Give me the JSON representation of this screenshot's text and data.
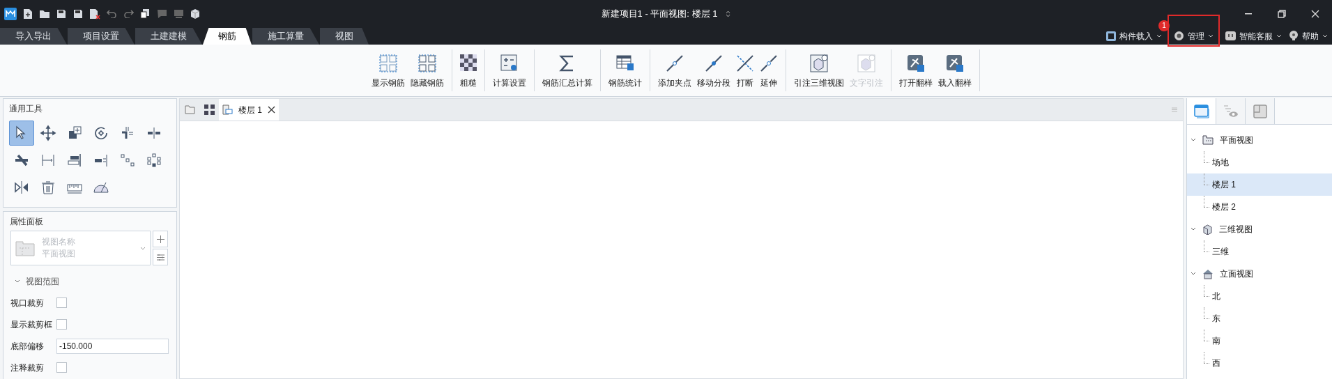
{
  "window": {
    "title": "新建项目1 - 平面视图: 楼层 1"
  },
  "main_tabs": [
    {
      "label": "导入导出",
      "selected": false
    },
    {
      "label": "项目设置",
      "selected": false
    },
    {
      "label": "土建建模",
      "selected": false
    },
    {
      "label": "钢筋",
      "selected": true
    },
    {
      "label": "施工算量",
      "selected": false
    },
    {
      "label": "视图",
      "selected": false
    }
  ],
  "right_menu": [
    {
      "label": "构件载入",
      "kind": "component"
    },
    {
      "label": "管理",
      "kind": "manage",
      "badge": "1",
      "highlighted": true
    },
    {
      "label": "智能客服",
      "kind": "service"
    },
    {
      "label": "帮助",
      "kind": "help"
    }
  ],
  "ribbon_groups": [
    [
      {
        "label": "显示钢筋",
        "kind": "show",
        "disabled": false
      },
      {
        "label": "隐藏钢筋",
        "kind": "hide",
        "disabled": false
      }
    ],
    [
      {
        "label": "粗糙",
        "kind": "rough",
        "disabled": false
      }
    ],
    [
      {
        "label": "计算设置",
        "kind": "calc",
        "disabled": false
      }
    ],
    [
      {
        "label": "钢筋汇总计算",
        "kind": "sum",
        "disabled": false
      }
    ],
    [
      {
        "label": "钢筋统计",
        "kind": "stats",
        "disabled": false
      }
    ],
    [
      {
        "label": "添加夹点",
        "kind": "addpoint",
        "disabled": false
      },
      {
        "label": "移动分段",
        "kind": "move",
        "disabled": false
      },
      {
        "label": "打断",
        "kind": "break",
        "disabled": false
      },
      {
        "label": "延伸",
        "kind": "extend",
        "disabled": false
      }
    ],
    [
      {
        "label": "引注三维视图",
        "kind": "view3d",
        "disabled": false
      },
      {
        "label": "文字引注",
        "kind": "view3d",
        "disabled": true
      }
    ],
    [
      {
        "label": "打开翻样",
        "kind": "open",
        "disabled": false
      },
      {
        "label": "载入翻样",
        "kind": "load",
        "disabled": false
      }
    ]
  ],
  "tools_panel": {
    "title": "通用工具",
    "tools": [
      {
        "kind": "select",
        "selected": true
      },
      {
        "kind": "move",
        "selected": false
      },
      {
        "kind": "copy",
        "selected": false
      },
      {
        "kind": "rotate",
        "selected": false
      },
      {
        "kind": "trim",
        "selected": false
      },
      {
        "kind": "split",
        "selected": false
      },
      {
        "kind": "offset",
        "selected": false
      },
      {
        "kind": "dimension",
        "selected": false
      },
      {
        "kind": "align",
        "selected": false
      },
      {
        "kind": "extend",
        "selected": false
      },
      {
        "kind": "array",
        "selected": false
      },
      {
        "kind": "group",
        "selected": false
      },
      {
        "kind": "mirror",
        "selected": false
      },
      {
        "kind": "delete",
        "selected": false
      },
      {
        "kind": "measure",
        "selected": false
      },
      {
        "kind": "angle",
        "selected": false
      }
    ]
  },
  "properties_panel": {
    "title": "属性面板",
    "view_selector": {
      "name": "视图名称",
      "value": "平面视图",
      "disabled": true
    },
    "section": {
      "label": "视图范围",
      "expanded": true
    },
    "fields": [
      {
        "label": "视口裁剪",
        "kind": "checkbox",
        "checked": false
      },
      {
        "label": "显示裁剪框",
        "kind": "checkbox",
        "checked": false
      },
      {
        "label": "底部偏移",
        "kind": "input",
        "value": "-150.000"
      },
      {
        "label": "注释裁剪",
        "kind": "checkbox",
        "checked": false
      }
    ]
  },
  "document_tabs": [
    {
      "label": "楼层 1",
      "selected": true
    }
  ],
  "project_browser": {
    "tabs": [
      {
        "kind": "views",
        "selected": true
      },
      {
        "kind": "visibility",
        "selected": false
      },
      {
        "kind": "model",
        "selected": false
      }
    ],
    "tree": [
      {
        "label": "平面视图",
        "kind": "plan",
        "expanded": true,
        "children": [
          {
            "label": "场地",
            "selected": false
          },
          {
            "label": "楼层 1",
            "selected": true
          },
          {
            "label": "楼层 2",
            "selected": false
          }
        ]
      },
      {
        "label": "三维视图",
        "kind": "cube",
        "expanded": true,
        "children": [
          {
            "label": "三维",
            "selected": false
          }
        ]
      },
      {
        "label": "立面视图",
        "kind": "elevation",
        "expanded": true,
        "children": [
          {
            "label": "北",
            "selected": false
          },
          {
            "label": "东",
            "selected": false
          },
          {
            "label": "南",
            "selected": false
          },
          {
            "label": "西",
            "selected": false
          }
        ]
      }
    ]
  }
}
